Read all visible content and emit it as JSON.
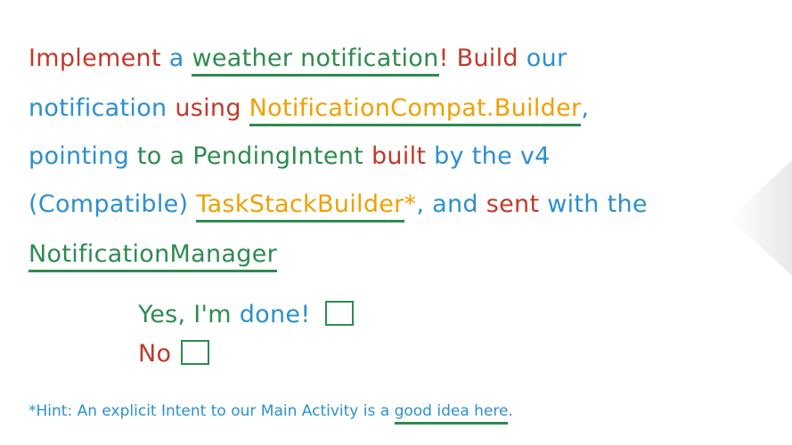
{
  "line1": [
    "Implement",
    "a",
    "weather notification",
    "!",
    "Build",
    "our"
  ],
  "line2": [
    "notification",
    "using",
    "NotificationCompat.Builder",
    ","
  ],
  "line3": [
    "pointing",
    "to a",
    "PendingIntent",
    "built",
    "by the",
    "v4"
  ],
  "line4": [
    "(Compatible)",
    "TaskStackBuilder",
    "*",
    ", and",
    "sent",
    "with the"
  ],
  "line5": [
    "NotificationManager"
  ],
  "options": {
    "yes": "Yes, I'm",
    "done": "done!",
    "no": "No"
  },
  "hint": [
    "*Hint: An explicit Intent to our Main Activity is a",
    "good idea here",
    "."
  ]
}
